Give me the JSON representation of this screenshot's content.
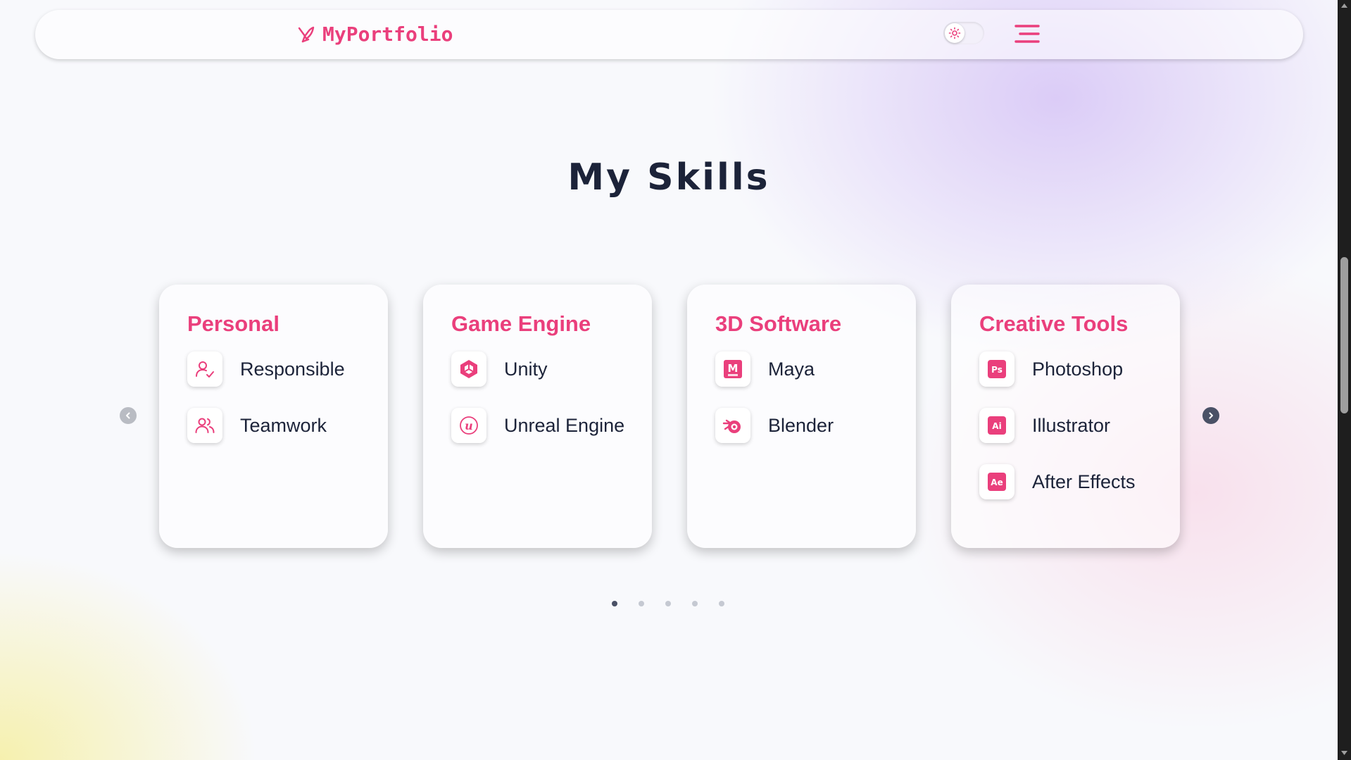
{
  "header": {
    "logo_text": "MyPortfolio",
    "theme_toggle_icon": "sun-icon",
    "menu_icon": "hamburger-menu-icon"
  },
  "section": {
    "title": "My Skills"
  },
  "cards": [
    {
      "title": "Personal",
      "skills": [
        {
          "label": "Responsible",
          "icon": "user-check-icon"
        },
        {
          "label": "Teamwork",
          "icon": "users-icon"
        }
      ]
    },
    {
      "title": "Game Engine",
      "skills": [
        {
          "label": "Unity",
          "icon": "unity-icon"
        },
        {
          "label": "Unreal Engine",
          "icon": "unreal-engine-icon"
        }
      ]
    },
    {
      "title": "3D Software",
      "skills": [
        {
          "label": "Maya",
          "icon": "maya-icon",
          "glyph": "M"
        },
        {
          "label": "Blender",
          "icon": "blender-icon"
        }
      ]
    },
    {
      "title": "Creative Tools",
      "skills": [
        {
          "label": "Photoshop",
          "icon": "photoshop-icon",
          "glyph": "Ps"
        },
        {
          "label": "Illustrator",
          "icon": "illustrator-icon",
          "glyph": "Ai"
        },
        {
          "label": "After Effects",
          "icon": "after-effects-icon",
          "glyph": "Ae"
        }
      ]
    }
  ],
  "carousel": {
    "dot_count": 5,
    "active_dot": 1
  },
  "colors": {
    "accent": "#ea3f7c",
    "heading": "#1c2339",
    "text": "#1c2339"
  }
}
